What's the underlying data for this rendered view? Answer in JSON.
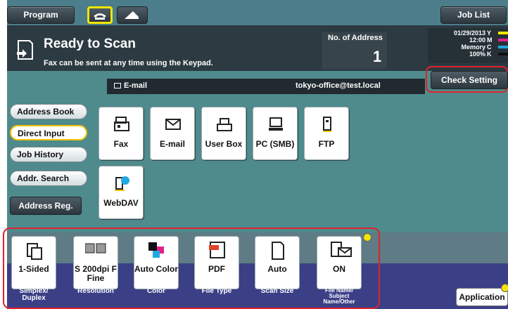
{
  "header": {
    "program_label": "Program",
    "job_list_label": "Job List"
  },
  "status": {
    "title": "Ready to Scan",
    "subtitle": "Fax can be sent at any time using the Keypad.",
    "address_label": "No. of Address",
    "address_count": "1",
    "date": "01/29/2013",
    "time": "12:00",
    "memory_label": "Memory",
    "memory_value": "100%",
    "toner": [
      "Y",
      "M",
      "C",
      "K"
    ],
    "toner_colors": [
      "#f5e400",
      "#e0218a",
      "#22a7e0",
      "#111111"
    ]
  },
  "destination": {
    "type": "E-mail",
    "address": "tokyo-office@test.local",
    "check_setting_label": "Check Setting"
  },
  "sidebar": {
    "items": [
      {
        "label": "Address Book"
      },
      {
        "label": "Direct Input"
      },
      {
        "label": "Job History"
      },
      {
        "label": "Addr. Search"
      }
    ],
    "address_reg_label": "Address Reg."
  },
  "tiles": [
    {
      "label": "Fax",
      "icon": "fax-icon"
    },
    {
      "label": "E-mail",
      "icon": "envelope-icon"
    },
    {
      "label": "User Box",
      "icon": "user-box-icon"
    },
    {
      "label": "PC (SMB)",
      "icon": "pc-icon"
    },
    {
      "label": "FTP",
      "icon": "ftp-icon"
    },
    {
      "label": "WebDAV",
      "icon": "webdav-icon"
    }
  ],
  "settings": [
    {
      "value": "1-Sided",
      "label": "Simplex/ Duplex"
    },
    {
      "value": "S 200dpi F Fine",
      "label": "Resolution"
    },
    {
      "value": "Auto Color",
      "label": "Color"
    },
    {
      "value": "PDF",
      "label": "File Type"
    },
    {
      "value": "Auto",
      "label": "Scan Size"
    },
    {
      "value": "ON",
      "label": "File Name/ Subject Name/Other"
    }
  ],
  "application_label": "Application"
}
